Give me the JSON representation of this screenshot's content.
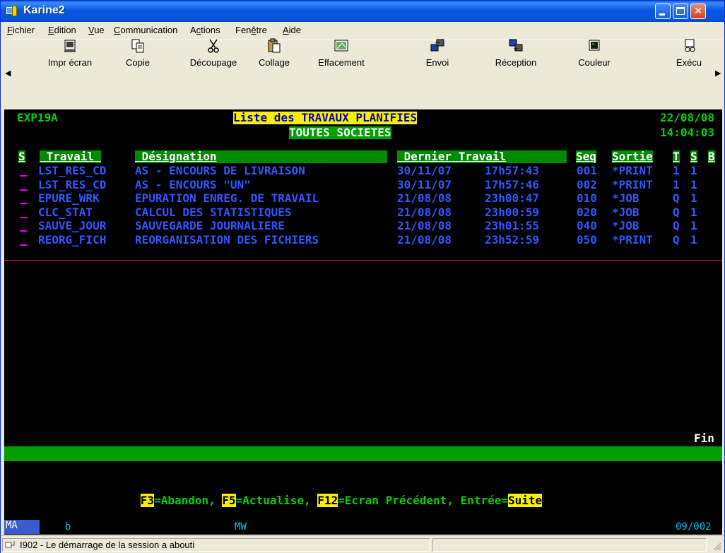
{
  "window": {
    "title": "Karine2"
  },
  "menu": [
    {
      "label": "Fichier",
      "u": "F"
    },
    {
      "label": "Edition",
      "u": "E"
    },
    {
      "label": "Vue",
      "u": "V"
    },
    {
      "label": "Communication",
      "u": "C"
    },
    {
      "label": "Actions",
      "u": "c"
    },
    {
      "label": "Fenêtre",
      "u": "ê"
    },
    {
      "label": "Aide",
      "u": "A"
    }
  ],
  "toolbar": [
    {
      "label": "Impr écran",
      "icon": "print-screen-icon"
    },
    {
      "label": "Copie",
      "icon": "copy-icon"
    },
    {
      "label": "Découpage",
      "icon": "cut-icon"
    },
    {
      "label": "Collage",
      "icon": "paste-icon"
    },
    {
      "label": "Effacement",
      "icon": "erase-icon"
    },
    {
      "label": "Envoi",
      "icon": "send-icon"
    },
    {
      "label": "Réception",
      "icon": "receive-icon"
    },
    {
      "label": "Couleur",
      "icon": "color-icon"
    },
    {
      "label": "Exécu",
      "icon": "execute-icon"
    }
  ],
  "terminal": {
    "program": "EXP19A",
    "title": "Liste des TRAVAUX PLANIFIES",
    "subtitle": "TOUTES SOCIETES",
    "date": "22/08/08",
    "time": "14:04:03",
    "headers": {
      "s": "S",
      "travail": " Travail ",
      "designation": " Désignation",
      "dernier": " Dernier Travail",
      "seq": "Seq",
      "sortie": "Sortie",
      "t": "T",
      "s2": "S",
      "b": "B"
    },
    "rows": [
      {
        "travail": "LST_RES_CD",
        "designation": "AS - ENCOURS DE LIVRAISON",
        "date": "30/11/07",
        "heure": "17h57:43",
        "seq": "001",
        "sortie": "*PRINT",
        "t": "1",
        "s": "1"
      },
      {
        "travail": "LST_RES_CD",
        "designation": "AS - ENCOURS \"UN\"",
        "date": "30/11/07",
        "heure": "17h57:46",
        "seq": "002",
        "sortie": "*PRINT",
        "t": "1",
        "s": "1"
      },
      {
        "travail": "EPURE_WRK",
        "designation": "EPURATION ENREG. DE TRAVAIL",
        "date": "21/08/08",
        "heure": "23h00:47",
        "seq": "010",
        "sortie": "*JOB",
        "t": "Q",
        "s": "1"
      },
      {
        "travail": "CLC_STAT",
        "designation": "CALCUL DES STATISTIQUES",
        "date": "21/08/08",
        "heure": "23h00:59",
        "seq": "020",
        "sortie": "*JOB",
        "t": "Q",
        "s": "1"
      },
      {
        "travail": "SAUVE_JOUR",
        "designation": "SAUVEGARDE JOURNALIERE",
        "date": "21/08/08",
        "heure": "23h01:55",
        "seq": "040",
        "sortie": "*JOB",
        "t": "Q",
        "s": "1"
      },
      {
        "travail": "REORG_FICH",
        "designation": "REORGANISATION DES FICHIERS",
        "date": "21/08/08",
        "heure": "23h52:59",
        "seq": "050",
        "sortie": "*PRINT",
        "t": "Q",
        "s": "1"
      }
    ],
    "fin": "Fin",
    "fkeys": [
      {
        "key": "F3",
        "text": "=Abandon, "
      },
      {
        "key": "F5",
        "text": "=Actualise, "
      },
      {
        "key": "F12",
        "text": "=Ecran Précédent, "
      },
      {
        "key": "Entrée",
        "text": "="
      },
      {
        "key": "Suite",
        "text": ""
      }
    ]
  },
  "oia": {
    "ma": "MA",
    "b": "b",
    "mw": "MW",
    "pos": "09/002"
  },
  "status": {
    "message": "I902 - Le démarrage de la session a abouti"
  }
}
